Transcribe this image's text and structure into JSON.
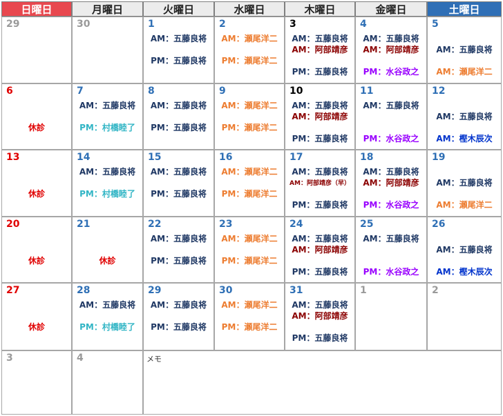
{
  "colors": {
    "sunday_header": "#e8484f",
    "saturday_header": "#2f6fb6",
    "weekday_header": "#ececec",
    "red": "#e00000",
    "blue": "#2e6fb5",
    "black": "#000000",
    "gray": "#9a9a9a",
    "staff_navy": "#1f3864",
    "staff_orange": "#ed7d31",
    "staff_maroon": "#8b0000",
    "staff_cyan": "#31b5c5",
    "staff_purple": "#9900ff",
    "staff_royal": "#0033cc"
  },
  "header": [
    "日曜日",
    "月曜日",
    "火曜日",
    "水曜日",
    "木曜日",
    "金曜日",
    "土曜日"
  ],
  "memo_label": "メモ",
  "weeks": [
    [
      {
        "day": "29",
        "c": "gray",
        "lines": []
      },
      {
        "day": "30",
        "c": "gray",
        "lines": []
      },
      {
        "day": "1",
        "c": "blue",
        "lines": [
          {
            "t": "AM：五藤良将",
            "c": "staff_navy",
            "y": 22
          },
          {
            "t": "PM：五藤良将",
            "c": "staff_navy",
            "y": 54
          }
        ]
      },
      {
        "day": "2",
        "c": "blue",
        "lines": [
          {
            "t": "AM：瀬尾洋二",
            "c": "staff_orange",
            "y": 22
          },
          {
            "t": "PM：瀬尾洋二",
            "c": "staff_orange",
            "y": 54
          }
        ]
      },
      {
        "day": "3",
        "c": "black",
        "lines": [
          {
            "t": "AM：五藤良将",
            "c": "staff_navy",
            "y": 22
          },
          {
            "t": "AM：阿部靖彦",
            "c": "staff_maroon",
            "y": 38
          },
          {
            "t": "PM：五藤良将",
            "c": "staff_navy",
            "y": 70
          }
        ]
      },
      {
        "day": "4",
        "c": "blue",
        "lines": [
          {
            "t": "AM：五藤良将",
            "c": "staff_navy",
            "y": 22
          },
          {
            "t": "AM：阿部靖彦",
            "c": "staff_maroon",
            "y": 38
          },
          {
            "t": "PM：水谷政之",
            "c": "staff_purple",
            "y": 70
          }
        ]
      },
      {
        "day": "5",
        "c": "blue",
        "lines": [
          {
            "t": "AM：五藤良将",
            "c": "staff_navy",
            "y": 38
          },
          {
            "t": "AM：瀬尾洋二",
            "c": "staff_orange",
            "y": 70
          }
        ]
      }
    ],
    [
      {
        "day": "6",
        "c": "red",
        "lines": [
          {
            "t": "休診",
            "c": "red",
            "y": 54
          }
        ]
      },
      {
        "day": "7",
        "c": "blue",
        "lines": [
          {
            "t": "AM：五藤良将",
            "c": "staff_navy",
            "y": 22
          },
          {
            "t": "PM：村橋睦了",
            "c": "staff_cyan",
            "y": 54
          }
        ]
      },
      {
        "day": "8",
        "c": "blue",
        "lines": [
          {
            "t": "AM：五藤良将",
            "c": "staff_navy",
            "y": 22
          },
          {
            "t": "PM：五藤良将",
            "c": "staff_navy",
            "y": 54
          }
        ]
      },
      {
        "day": "9",
        "c": "blue",
        "lines": [
          {
            "t": "AM：瀬尾洋二",
            "c": "staff_orange",
            "y": 22
          },
          {
            "t": "PM：瀬尾洋二",
            "c": "staff_orange",
            "y": 54
          }
        ]
      },
      {
        "day": "10",
        "c": "black",
        "lines": [
          {
            "t": "AM：五藤良将",
            "c": "staff_navy",
            "y": 22
          },
          {
            "t": "AM：阿部靖彦",
            "c": "staff_maroon",
            "y": 38
          },
          {
            "t": "PM：五藤良将",
            "c": "staff_navy",
            "y": 70
          }
        ]
      },
      {
        "day": "11",
        "c": "blue",
        "lines": [
          {
            "t": "AM：五藤良将",
            "c": "staff_navy",
            "y": 22
          },
          {
            "t": "PM：水谷政之",
            "c": "staff_purple",
            "y": 70
          }
        ]
      },
      {
        "day": "12",
        "c": "blue",
        "lines": [
          {
            "t": "AM：五藤良将",
            "c": "staff_navy",
            "y": 38
          },
          {
            "t": "AM：樫木辰次",
            "c": "staff_royal",
            "y": 70
          }
        ]
      }
    ],
    [
      {
        "day": "13",
        "c": "red",
        "lines": [
          {
            "t": "休診",
            "c": "red",
            "y": 54
          }
        ]
      },
      {
        "day": "14",
        "c": "blue",
        "lines": [
          {
            "t": "AM：五藤良将",
            "c": "staff_navy",
            "y": 22
          },
          {
            "t": "PM：村橋睦了",
            "c": "staff_cyan",
            "y": 54
          }
        ]
      },
      {
        "day": "15",
        "c": "blue",
        "lines": [
          {
            "t": "AM：五藤良将",
            "c": "staff_navy",
            "y": 22
          },
          {
            "t": "PM：五藤良将",
            "c": "staff_navy",
            "y": 54
          }
        ]
      },
      {
        "day": "16",
        "c": "blue",
        "lines": [
          {
            "t": "AM：瀬尾洋二",
            "c": "staff_orange",
            "y": 22
          },
          {
            "t": "PM：瀬尾洋二",
            "c": "staff_orange",
            "y": 54
          }
        ]
      },
      {
        "day": "17",
        "c": "blue",
        "lines": [
          {
            "t": "AM：五藤良将",
            "c": "staff_navy",
            "y": 22
          },
          {
            "t": "AM：阿部靖彦（早）",
            "c": "staff_maroon",
            "y": 40,
            "small": true
          },
          {
            "t": "PM：五藤良将",
            "c": "staff_navy",
            "y": 70
          }
        ]
      },
      {
        "day": "18",
        "c": "blue",
        "lines": [
          {
            "t": "AM：五藤良将",
            "c": "staff_navy",
            "y": 22
          },
          {
            "t": "AM：阿部靖彦",
            "c": "staff_maroon",
            "y": 38
          },
          {
            "t": "PM：水谷政之",
            "c": "staff_purple",
            "y": 70
          }
        ]
      },
      {
        "day": "19",
        "c": "blue",
        "lines": [
          {
            "t": "AM：五藤良将",
            "c": "staff_navy",
            "y": 38
          },
          {
            "t": "AM：瀬尾洋二",
            "c": "staff_orange",
            "y": 70
          }
        ]
      }
    ],
    [
      {
        "day": "20",
        "c": "red",
        "lines": [
          {
            "t": "休診",
            "c": "red",
            "y": 54
          }
        ]
      },
      {
        "day": "21",
        "c": "blue",
        "lines": [
          {
            "t": "休診",
            "c": "red",
            "y": 54
          }
        ]
      },
      {
        "day": "22",
        "c": "blue",
        "lines": [
          {
            "t": "AM：五藤良将",
            "c": "staff_navy",
            "y": 22
          },
          {
            "t": "PM：五藤良将",
            "c": "staff_navy",
            "y": 54
          }
        ]
      },
      {
        "day": "23",
        "c": "blue",
        "lines": [
          {
            "t": "AM：瀬尾洋二",
            "c": "staff_orange",
            "y": 22
          },
          {
            "t": "PM：瀬尾洋二",
            "c": "staff_orange",
            "y": 54
          }
        ]
      },
      {
        "day": "24",
        "c": "blue",
        "lines": [
          {
            "t": "AM：五藤良将",
            "c": "staff_navy",
            "y": 22
          },
          {
            "t": "AM：阿部靖彦",
            "c": "staff_maroon",
            "y": 38
          },
          {
            "t": "PM：五藤良将",
            "c": "staff_navy",
            "y": 70
          }
        ]
      },
      {
        "day": "25",
        "c": "blue",
        "lines": [
          {
            "t": "AM：五藤良将",
            "c": "staff_navy",
            "y": 22
          },
          {
            "t": "PM：水谷政之",
            "c": "staff_purple",
            "y": 70
          }
        ]
      },
      {
        "day": "26",
        "c": "blue",
        "lines": [
          {
            "t": "AM：五藤良将",
            "c": "staff_navy",
            "y": 38
          },
          {
            "t": "AM：樫木辰次",
            "c": "staff_royal",
            "y": 70
          }
        ]
      }
    ],
    [
      {
        "day": "27",
        "c": "red",
        "lines": [
          {
            "t": "休診",
            "c": "red",
            "y": 54
          }
        ]
      },
      {
        "day": "28",
        "c": "blue",
        "lines": [
          {
            "t": "AM：五藤良将",
            "c": "staff_navy",
            "y": 22
          },
          {
            "t": "PM：村橋睦了",
            "c": "staff_cyan",
            "y": 54
          }
        ]
      },
      {
        "day": "29",
        "c": "blue",
        "lines": [
          {
            "t": "AM：五藤良将",
            "c": "staff_navy",
            "y": 22
          },
          {
            "t": "PM：五藤良将",
            "c": "staff_navy",
            "y": 54
          }
        ]
      },
      {
        "day": "30",
        "c": "blue",
        "lines": [
          {
            "t": "AM：瀬尾洋二",
            "c": "staff_orange",
            "y": 22
          },
          {
            "t": "PM：瀬尾洋二",
            "c": "staff_orange",
            "y": 54
          }
        ]
      },
      {
        "day": "31",
        "c": "blue",
        "lines": [
          {
            "t": "AM：五藤良将",
            "c": "staff_navy",
            "y": 22
          },
          {
            "t": "AM：阿部靖彦",
            "c": "staff_maroon",
            "y": 38
          },
          {
            "t": "PM：五藤良将",
            "c": "staff_navy",
            "y": 70
          }
        ]
      },
      {
        "day": "1",
        "c": "gray",
        "lines": []
      },
      {
        "day": "2",
        "c": "gray",
        "lines": []
      }
    ]
  ],
  "last_row": [
    {
      "day": "3",
      "c": "gray"
    },
    {
      "day": "4",
      "c": "gray"
    }
  ]
}
